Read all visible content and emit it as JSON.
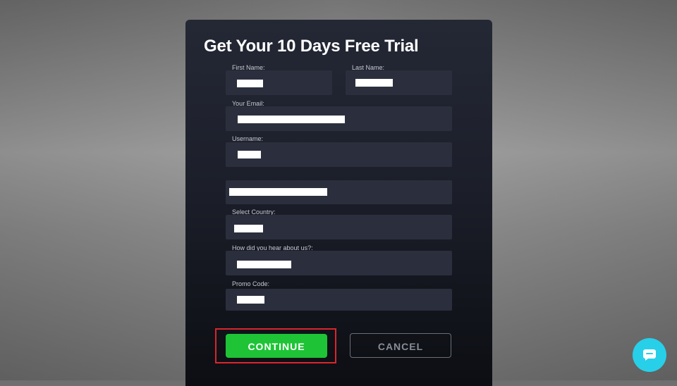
{
  "modal": {
    "title": "Get Your 10 Days Free Trial"
  },
  "form": {
    "first_name_label": "First Name:",
    "last_name_label": "Last Name:",
    "email_label": "Your Email:",
    "username_label": "Username:",
    "country_label": "Select Country:",
    "hear_label": "How did you hear about us?:",
    "promo_label": "Promo Code:"
  },
  "actions": {
    "continue_label": "CONTINUE",
    "cancel_label": "CANCEL"
  },
  "colors": {
    "accent_green": "#1ec436",
    "highlight_red": "#d9262b",
    "chat_cyan": "#27d0e8"
  },
  "icons": {
    "chat": "chat-bubble-icon"
  }
}
